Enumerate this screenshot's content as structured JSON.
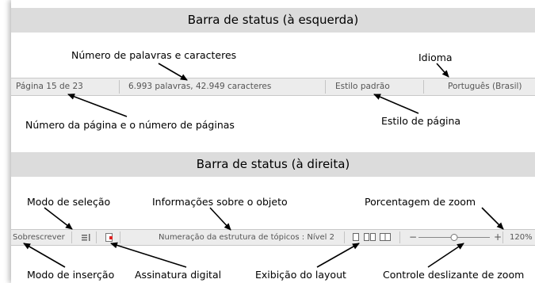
{
  "top": {
    "title": "Barra de status (à esquerda)",
    "status_bar": {
      "page": "Página 15 de 23",
      "words": "6.993 palavras, 42.949 caracteres",
      "style": "Estilo padrão",
      "language": "Português (Brasil)"
    },
    "callouts": {
      "words": "Número de palavras e caracteres",
      "language": "Idioma",
      "page": "Número da página e o número de páginas",
      "style": "Estilo de página"
    }
  },
  "bottom": {
    "title": "Barra de status (à direita)",
    "status_bar": {
      "insert_mode": "Sobrescrever",
      "outline": "Numeração da estrutura de tópicos : Nível 2",
      "zoom_minus": "−",
      "zoom_plus": "+",
      "zoom_value": "120%"
    },
    "callouts": {
      "selection_mode": "Modo de seleção",
      "object_info": "Informações sobre o objeto",
      "zoom_percent": "Porcentagem de zoom",
      "insert_mode": "Modo de inserção",
      "signature": "Assinatura digital",
      "layout": "Exibição do layout",
      "zoom_slider": "Controle deslizante de zoom"
    }
  },
  "zoom_slider_fraction": 0.5,
  "icons": [
    "selection-mode-icon",
    "digital-signature-icon",
    "single-page-view-icon",
    "multi-page-view-icon",
    "book-view-icon",
    "zoom-slider-thumb-icon"
  ]
}
